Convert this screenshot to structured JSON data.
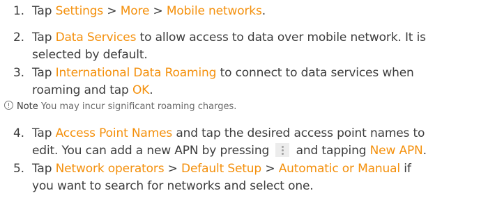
{
  "steps": [
    {
      "number": "1.",
      "lines": [
        {
          "segments": [
            {
              "text": "Tap ",
              "hl": false
            },
            {
              "text": "Settings",
              "hl": true
            },
            {
              "text": " > ",
              "hl": false
            },
            {
              "text": "More",
              "hl": true
            },
            {
              "text": " > ",
              "hl": false
            },
            {
              "text": "Mobile networks",
              "hl": true
            },
            {
              "text": ".",
              "hl": false
            }
          ]
        }
      ]
    },
    {
      "number": "2.",
      "lines": [
        {
          "segments": [
            {
              "text": "Tap ",
              "hl": false
            },
            {
              "text": "Data Services",
              "hl": true
            },
            {
              "text": " to allow access to data over mobile network. It is",
              "hl": false
            }
          ]
        },
        {
          "segments": [
            {
              "text": "selected by default.",
              "hl": false
            }
          ]
        }
      ]
    },
    {
      "number": "3.",
      "lines": [
        {
          "segments": [
            {
              "text": "Tap ",
              "hl": false
            },
            {
              "text": "International Data Roaming",
              "hl": true
            },
            {
              "text": " to connect to data services when",
              "hl": false
            }
          ]
        },
        {
          "segments": [
            {
              "text": "roaming and tap ",
              "hl": false
            },
            {
              "text": "OK",
              "hl": true
            },
            {
              "text": ".",
              "hl": false
            }
          ]
        }
      ]
    },
    {
      "number": "4.",
      "lines": [
        {
          "segments": [
            {
              "text": "Tap ",
              "hl": false
            },
            {
              "text": "Access Point Names",
              "hl": true
            },
            {
              "text": " and tap the desired access point names to",
              "hl": false
            }
          ]
        },
        {
          "segments": [
            {
              "text": "edit. You can add a new APN by pressing ",
              "hl": false
            },
            {
              "icon": "menu-icon"
            },
            {
              "text": " and tapping ",
              "hl": false
            },
            {
              "text": "New APN",
              "hl": true
            },
            {
              "text": ".",
              "hl": false
            }
          ]
        }
      ]
    },
    {
      "number": "5.",
      "lines": [
        {
          "segments": [
            {
              "text": "Tap ",
              "hl": false
            },
            {
              "text": "Network operators",
              "hl": true
            },
            {
              "text": " > ",
              "hl": false
            },
            {
              "text": "Default Setup",
              "hl": true
            },
            {
              "text": " > ",
              "hl": false
            },
            {
              "text": "Automatic or Manual",
              "hl": true
            },
            {
              "text": " if",
              "hl": false
            }
          ]
        },
        {
          "segments": [
            {
              "text": "you want to search for networks and select one.",
              "hl": false
            }
          ]
        }
      ]
    }
  ],
  "note": {
    "label": "Note",
    "text": " You may incur significant roaming charges.",
    "icon": "info-icon"
  },
  "colors": {
    "highlight": "#f4900c",
    "body_text": "#3d3d3d"
  }
}
